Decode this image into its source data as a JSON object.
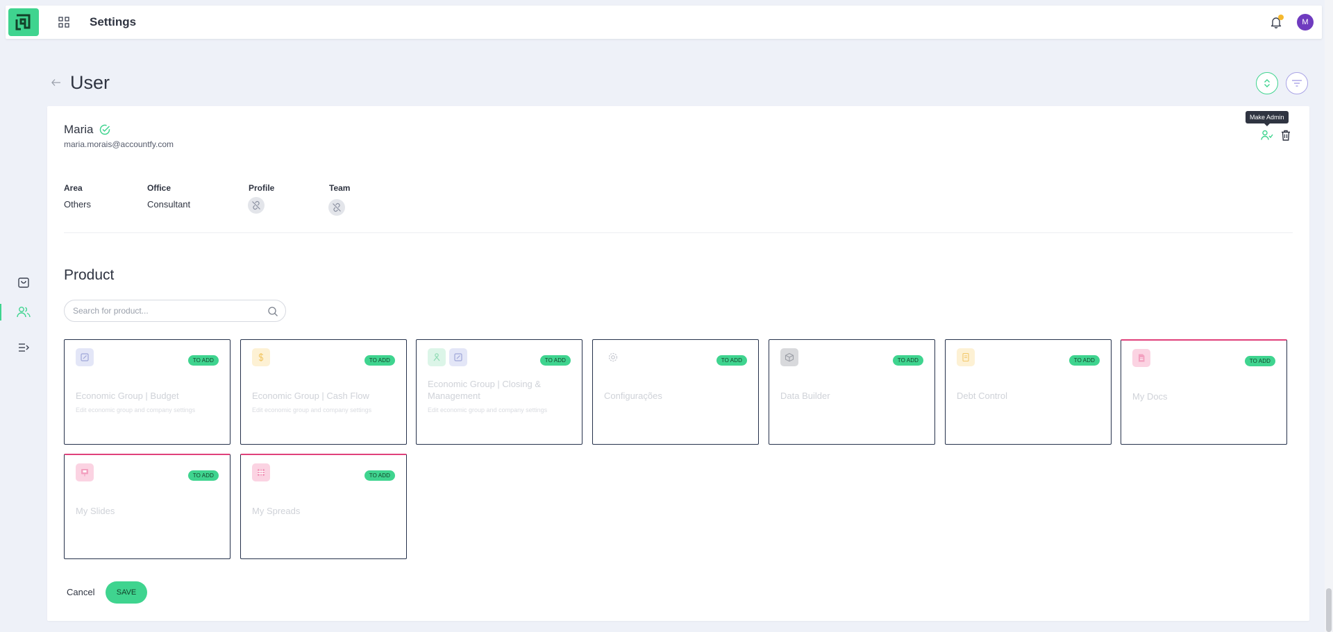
{
  "header": {
    "title": "Settings",
    "avatar_initial": "M"
  },
  "page": {
    "title": "User"
  },
  "user": {
    "name": "Maria",
    "email": "maria.morais@accountfy.com",
    "tooltip": "Make Admin",
    "fields": [
      {
        "label": "Area",
        "value": "Others"
      },
      {
        "label": "Office",
        "value": "Consultant"
      },
      {
        "label": "Profile"
      },
      {
        "label": "Team"
      }
    ]
  },
  "product": {
    "title": "Product",
    "search_placeholder": "Search for product...",
    "badge": "TO ADD",
    "items": [
      {
        "name": "Economic Group | Budget",
        "desc": "Edit economic group and company settings",
        "icon": "edit-icon"
      },
      {
        "name": "Economic Group | Cash Flow",
        "desc": "Edit economic group and company settings",
        "icon": "dollar-icon"
      },
      {
        "name": "Economic Group | Closing & Management",
        "desc": "Edit economic group and company settings",
        "icon": "users-icon"
      },
      {
        "name": "Configurações",
        "icon": "gear-icon"
      },
      {
        "name": "Data Builder",
        "icon": "box-icon"
      },
      {
        "name": "Debt Control",
        "icon": "document-icon"
      },
      {
        "name": "My Docs",
        "icon": "doc-icon"
      },
      {
        "name": "My Slides",
        "icon": "slides-icon"
      },
      {
        "name": "My Spreads",
        "icon": "grid-icon"
      }
    ]
  },
  "actions": {
    "cancel": "Cancel",
    "save": "SAVE"
  },
  "colors": {
    "accent": "#3fd48f",
    "avatar": "#6f3bbf",
    "card_border": "#24304a",
    "pink_accent": "#e0407a"
  }
}
